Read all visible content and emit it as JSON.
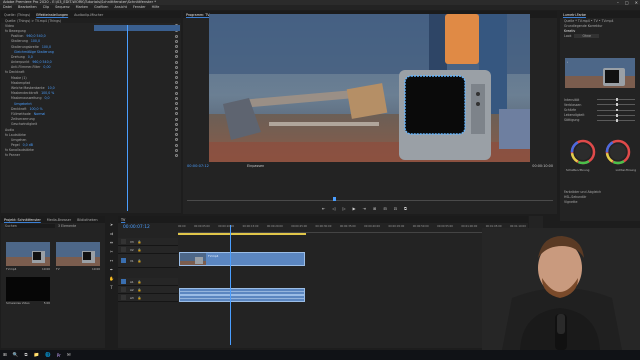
{
  "window": {
    "title": "Adobe Premiere Pro 2020 - E:\\03_EDIT-WORK\\Tutorials\\Schnittfenster\\Schnittfenster *",
    "controls": [
      "–",
      "□",
      "✕"
    ]
  },
  "menu": [
    "Datei",
    "Bearbeiten",
    "Clip",
    "Sequenz",
    "Marken",
    "Grafiken",
    "Ansicht",
    "Fenster",
    "Hilfe"
  ],
  "effect_controls": {
    "tabs": [
      "Quelle: (Things)",
      "Effekteinstellungen",
      "Audioclip-Mischer",
      "Quelle: TV.mp4"
    ],
    "active_tab": "Effekteinstellungen",
    "clip_label": "Quelle: (Things) > TV.mp4 (Things)",
    "sections": [
      {
        "label": "Video",
        "value": ""
      },
      {
        "label": "fx Bewegung",
        "value": ""
      },
      {
        "label": "Position",
        "value": "960,0  540,0"
      },
      {
        "label": "Skalierung",
        "value": "100,0"
      },
      {
        "label": "Skalierungsbreite",
        "value": "100,0"
      },
      {
        "label": "",
        "value": "Gleichmäßige Skalierung"
      },
      {
        "label": "Drehung",
        "value": "0,0"
      },
      {
        "label": "Ankerpunkt",
        "value": "960,0  540,0"
      },
      {
        "label": "Anti-Flimmer-Filter",
        "value": "0,00"
      },
      {
        "label": "fx Deckkraft",
        "value": ""
      },
      {
        "label": "Maske (1)",
        "value": ""
      },
      {
        "label": "Maskenpfad",
        "value": ""
      },
      {
        "label": "Weiche Maskenkante",
        "value": "10,0"
      },
      {
        "label": "Maskendeckkraft",
        "value": "100,0 %"
      },
      {
        "label": "Maskenausweitung",
        "value": "0,0"
      },
      {
        "label": "",
        "value": "Umgekehrt"
      },
      {
        "label": "Deckkraft",
        "value": "100,0 %"
      },
      {
        "label": "Füllmethode",
        "value": "Normal"
      },
      {
        "label": "Zeitverzerrung",
        "value": ""
      },
      {
        "label": "Geschwindigkeit",
        "value": ""
      },
      {
        "label": "Audio",
        "value": ""
      },
      {
        "label": "fx Lautstärke",
        "value": ""
      },
      {
        "label": "Umgehen",
        "value": ""
      },
      {
        "label": "Pegel",
        "value": "0,0 dB"
      },
      {
        "label": "fx Kanallautstärke",
        "value": ""
      },
      {
        "label": "fx Panner",
        "value": ""
      }
    ]
  },
  "program": {
    "title": "Programm: TV",
    "timecode": "00:00:07:12",
    "fit": "Einpassen",
    "duration": "00:00:10:00",
    "transport": [
      "⇤",
      "◁",
      "▷",
      "▶",
      "⇥",
      "⊞",
      "⊟",
      "⊡",
      "⧉"
    ]
  },
  "lumetri": {
    "title": "Lumetri-Farbe",
    "target": "Quelle * TV.mp4 • TV • TV.mp4",
    "sections": [
      "Grundlegende Korrektur",
      "Kreativ",
      "Look",
      "Kurven",
      "Farbräder und Abgleich",
      "HSL-Sekundär",
      "Vignette"
    ],
    "look_label": "Look",
    "look_value": "Ohne",
    "sliders": [
      "Intensität",
      "Verblassen",
      "Schärfe",
      "Lebendigkeit",
      "Sättigung"
    ],
    "wheels": [
      "Schatten-Tönung",
      "Lichter-Tönung"
    ]
  },
  "project": {
    "tabs": [
      "Projekt: Schnittfenster",
      "Media-Browser",
      "Bibliotheken"
    ],
    "search_placeholder": "Suchen",
    "count": "3 Elemente",
    "items": [
      {
        "name": "TV.mp4",
        "duration": "10:00"
      },
      {
        "name": "TV",
        "duration": "10:00"
      },
      {
        "name": "Schwarzes Video",
        "duration": "5:00"
      }
    ]
  },
  "timeline": {
    "tab": "TV",
    "timecode": "00:00:07:12",
    "ruler": [
      "00:00",
      "00:00:05:00",
      "00:00:10:00",
      "00:00:15:00",
      "00:00:20:00",
      "00:00:25:00",
      "00:00:30:00",
      "00:00:35:00",
      "00:00:40:00",
      "00:00:45:00",
      "00:00:50:00",
      "00:00:55:00",
      "00:01:00:00",
      "00:01:05:00",
      "00:01:10:00"
    ],
    "tracks": [
      "V3",
      "V2",
      "V1",
      "A1",
      "A2",
      "A3"
    ],
    "clips": [
      {
        "label": "TV.mp4",
        "track": "V1"
      },
      {
        "label": "",
        "track": "A1"
      },
      {
        "label": "",
        "track": "A2"
      }
    ]
  },
  "meter": {
    "db": [
      "0",
      "-12",
      "-24",
      "-36",
      "-48",
      "dB"
    ]
  },
  "taskbar": {
    "icons": [
      "⊞",
      "🔍",
      "⧉",
      "📁",
      "🌐",
      "Pr",
      "✉"
    ],
    "clock": "15:42"
  },
  "colors": {
    "accent": "#4a9eff",
    "bg": "#1d1d1d",
    "clip": "#5b86c0"
  }
}
